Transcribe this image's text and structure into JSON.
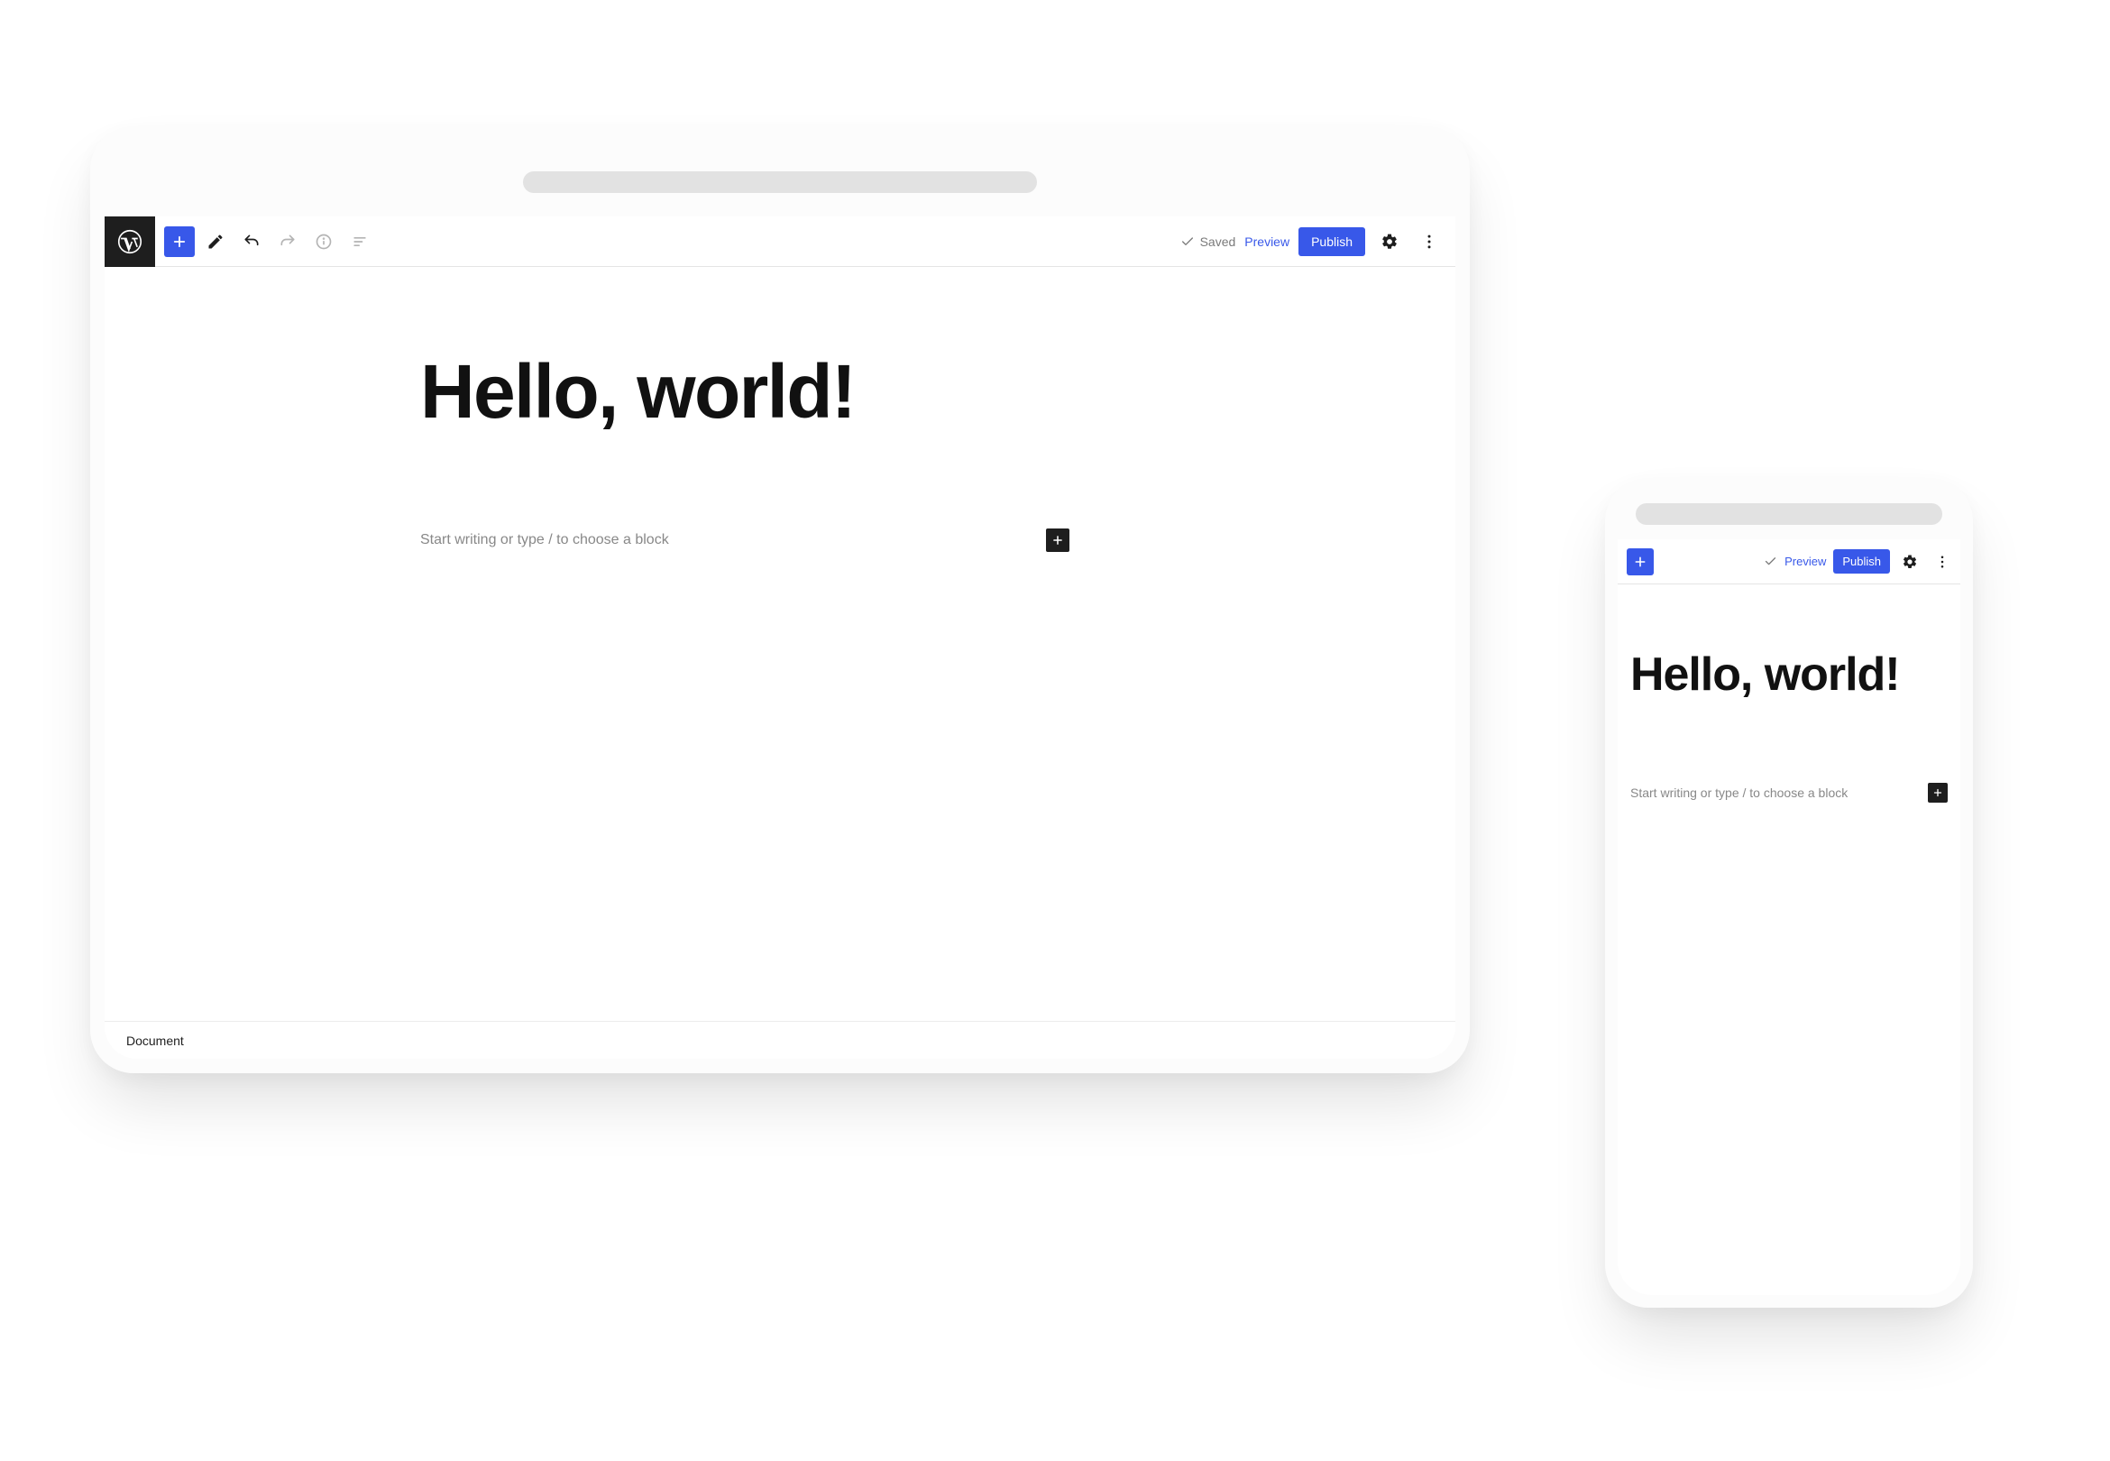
{
  "tablet": {
    "toolbar": {
      "saved_label": "Saved",
      "preview_label": "Preview",
      "publish_label": "Publish"
    },
    "document": {
      "title": "Hello, world!",
      "block_placeholder": "Start writing or type / to choose a block"
    },
    "footer": {
      "breadcrumb": "Document"
    }
  },
  "phone": {
    "toolbar": {
      "preview_label": "Preview",
      "publish_label": "Publish"
    },
    "document": {
      "title": "Hello, world!",
      "block_placeholder": "Start writing or type / to choose a block"
    }
  },
  "colors": {
    "accent": "#3858e9",
    "logo_bg": "#1e1e1e"
  }
}
